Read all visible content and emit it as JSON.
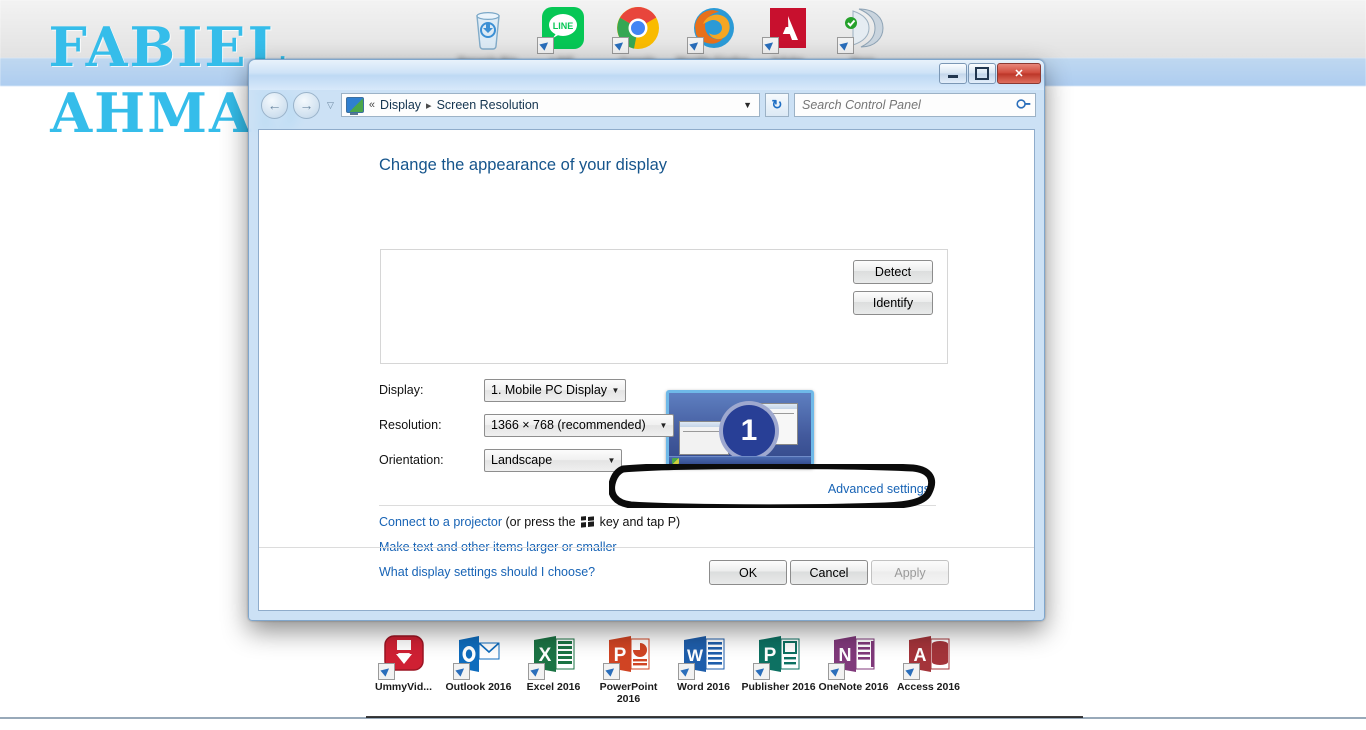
{
  "desktop": {
    "watermark": {
      "line1": "FABIEL",
      "line2": "AHMAD",
      "color": "#35bdea"
    },
    "top_icons": [
      {
        "name": "recycle-bin",
        "label": "Recycle Bin"
      },
      {
        "name": "line",
        "label": "LINE"
      },
      {
        "name": "google-chrome",
        "label": "Google Chrome"
      },
      {
        "name": "mozilla-firefox",
        "label": "Mozilla Firefox"
      },
      {
        "name": "adobe",
        "label": "Adobe Application"
      },
      {
        "name": "nero",
        "label": "Nero StartSmart"
      }
    ],
    "bottom_icons": [
      {
        "name": "ummy-video-downloader",
        "label": "UmmyVid..."
      },
      {
        "name": "outlook-2016",
        "label": "Outlook 2016"
      },
      {
        "name": "excel-2016",
        "label": "Excel 2016"
      },
      {
        "name": "powerpoint-2016",
        "label": "PowerPoint 2016"
      },
      {
        "name": "word-2016",
        "label": "Word 2016"
      },
      {
        "name": "publisher-2016",
        "label": "Publisher 2016"
      },
      {
        "name": "onenote-2016",
        "label": "OneNote 2016"
      },
      {
        "name": "access-2016",
        "label": "Access 2016"
      }
    ]
  },
  "window": {
    "controls": {
      "minimize": "–",
      "maximize": "▭",
      "close": "✕"
    },
    "nav": {
      "back": "←",
      "forward": "→",
      "recent_caret": "▽",
      "refresh": "↻",
      "breadcrumb_prefix": "«",
      "breadcrumb_items": [
        "Display",
        "Screen Resolution"
      ],
      "breadcrumb_separator": "▸",
      "dropdown_caret": "▼"
    },
    "search": {
      "placeholder": "Search Control Panel",
      "value": "",
      "icon": "⚲"
    }
  },
  "page": {
    "heading": "Change the appearance of your display",
    "monitor_number": "1",
    "side_buttons": [
      {
        "name": "detect",
        "label": "Detect"
      },
      {
        "name": "identify",
        "label": "Identify"
      }
    ],
    "fields": [
      {
        "name": "display",
        "label": "Display:",
        "value": "1. Mobile PC Display",
        "caret": "▼"
      },
      {
        "name": "resolution",
        "label": "Resolution:",
        "value": "1366 × 768 (recommended)",
        "caret": "▼"
      },
      {
        "name": "orientation",
        "label": "Orientation:",
        "value": "Landscape",
        "caret": "▼"
      }
    ],
    "advanced_settings": "Advanced settings",
    "projector_link": "Connect to a projector",
    "projector_suffix_before": " (or press the ",
    "projector_suffix_after": " key and tap P)",
    "links": [
      "Make text and other items larger or smaller",
      "What display settings should I choose?"
    ],
    "dialog_buttons": [
      {
        "name": "ok",
        "label": "OK",
        "enabled": "true"
      },
      {
        "name": "cancel",
        "label": "Cancel",
        "enabled": "true"
      },
      {
        "name": "apply",
        "label": "Apply",
        "enabled": "false"
      }
    ]
  },
  "annotation": {
    "shape": "hand-drawn-oval",
    "target": "resolution-row",
    "color": "#000000"
  }
}
